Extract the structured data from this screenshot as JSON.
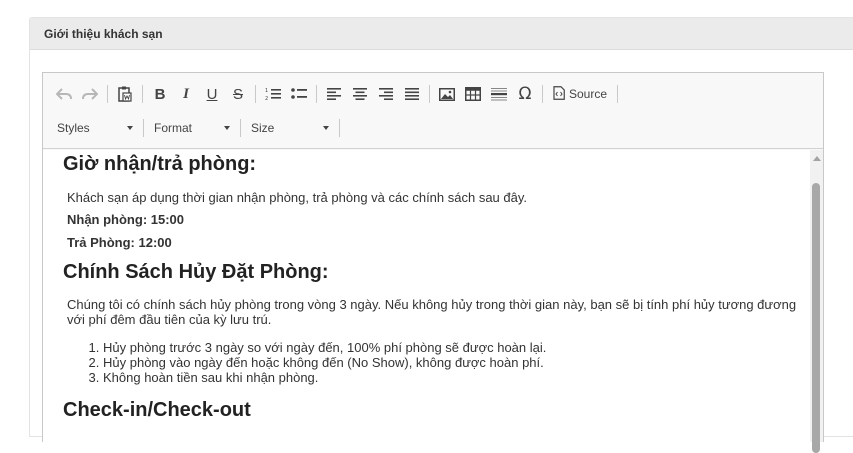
{
  "panel": {
    "title": "Giới thiệu khách sạn"
  },
  "toolbar": {
    "source_label": "Source",
    "styles_label": "Styles",
    "format_label": "Format",
    "size_label": "Size",
    "icons": [
      "undo-icon",
      "redo-icon",
      "paste-from-word-icon",
      "bold-icon",
      "italic-icon",
      "underline-icon",
      "strikethrough-icon",
      "numbered-list-icon",
      "bulleted-list-icon",
      "align-left-icon",
      "align-center-icon",
      "align-right-icon",
      "justify-icon",
      "image-icon",
      "table-icon",
      "horizontal-line-icon",
      "special-character-icon",
      "source-icon"
    ]
  },
  "content": {
    "section1": {
      "heading": "Giờ nhận/trả phòng:",
      "intro": "Khách sạn áp dụng thời gian nhận phòng, trả phòng và các chính sách sau đây.",
      "checkin": "Nhận phòng: 15:00",
      "checkout": "Trả Phòng: 12:00"
    },
    "section2": {
      "heading": "Chính Sách Hủy Đặt Phòng:",
      "intro": "Chúng tôi có chính sách hủy phòng trong vòng 3 ngày. Nếu không hủy trong thời gian này, bạn sẽ bị tính phí hủy tương đương với phí đêm đầu tiên của kỳ lưu trú.",
      "rules": [
        "Hủy phòng trước 3 ngày so với ngày đến, 100% phí phòng sẽ được hoàn lại.",
        "Hủy phòng vào ngày đến hoặc không đến (No Show), không được hoàn phí.",
        "Không hoàn tiền sau khi nhận phòng."
      ]
    },
    "section3": {
      "heading": "Check-in/Check-out"
    }
  }
}
